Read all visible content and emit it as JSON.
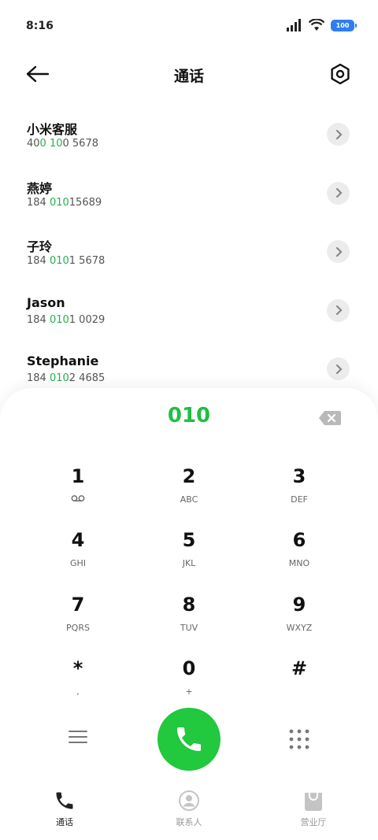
{
  "status": {
    "time": "8:16",
    "battery": "100"
  },
  "header": {
    "title": "通话"
  },
  "contacts": [
    {
      "name": "小米客服",
      "num_pre": "40",
      "num_hl": "0 10",
      "num_post": "0 5678"
    },
    {
      "name": "燕婷",
      "num_pre": "184 ",
      "num_hl": "010",
      "num_post": "15689"
    },
    {
      "name": "子玲",
      "num_pre": "184 ",
      "num_hl": "010",
      "num_post": "1 5678"
    },
    {
      "name": "Jason",
      "num_pre": "184 ",
      "num_hl": "010",
      "num_post": "1 0029"
    },
    {
      "name": "Stephanie",
      "num_pre": "184 ",
      "num_hl": "010",
      "num_post": "2 4685"
    }
  ],
  "dialer": {
    "input": "010",
    "keys": [
      {
        "digit": "1",
        "letters": ""
      },
      {
        "digit": "2",
        "letters": "ABC"
      },
      {
        "digit": "3",
        "letters": "DEF"
      },
      {
        "digit": "4",
        "letters": "GHI"
      },
      {
        "digit": "5",
        "letters": "JKL"
      },
      {
        "digit": "6",
        "letters": "MNO"
      },
      {
        "digit": "7",
        "letters": "PQRS"
      },
      {
        "digit": "8",
        "letters": "TUV"
      },
      {
        "digit": "9",
        "letters": "WXYZ"
      },
      {
        "digit": "*",
        "letters": ","
      },
      {
        "digit": "0",
        "letters": "+"
      },
      {
        "digit": "#",
        "letters": ""
      }
    ]
  },
  "tabs": [
    {
      "label": "通话",
      "active": true
    },
    {
      "label": "联系人",
      "active": false
    },
    {
      "label": "营业厅",
      "active": false
    }
  ],
  "colors": {
    "accent": "#22c83e",
    "highlight": "#22b24c",
    "battery": "#2f7ef0"
  }
}
